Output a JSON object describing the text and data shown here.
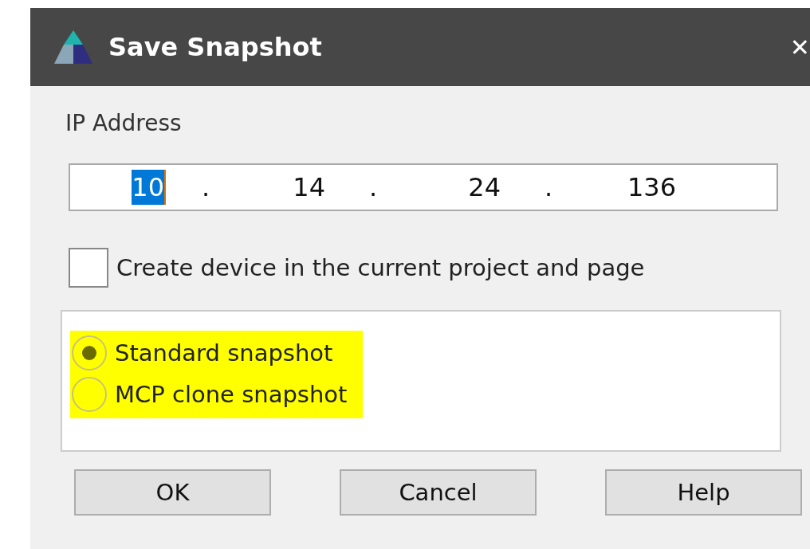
{
  "window": {
    "title": "Save Snapshot",
    "close": "✕"
  },
  "ip_label": "IP Address",
  "ip_field": {
    "octets": [
      {
        "value": "10",
        "selected": true
      },
      {
        "value": "14",
        "selected": false
      },
      {
        "value": "24",
        "selected": false
      },
      {
        "value": "136",
        "selected": false
      }
    ],
    "separators": [
      ".",
      ".",
      "."
    ]
  },
  "create_device": {
    "label": "Create device in the current project and page",
    "checked": false
  },
  "snapshot_type": {
    "highlighted": true,
    "options": [
      {
        "label": "Standard snapshot",
        "selected": true
      },
      {
        "label": "MCP clone snapshot",
        "selected": false
      }
    ]
  },
  "buttons": [
    "OK",
    "Cancel",
    "Help"
  ]
}
